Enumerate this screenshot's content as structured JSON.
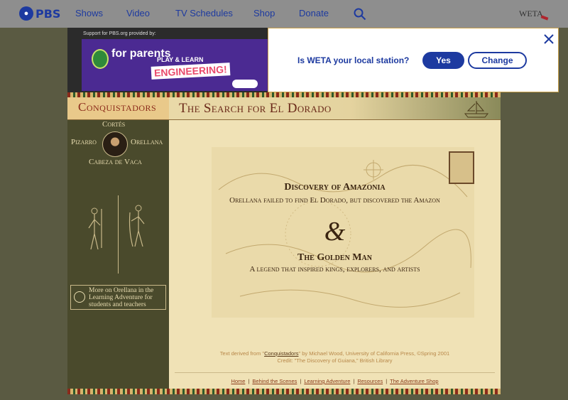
{
  "nav": {
    "logo": "PBS",
    "items": [
      "Shows",
      "Video",
      "TV Schedules",
      "Shop",
      "Donate"
    ],
    "station_logo": "WETA"
  },
  "ad": {
    "support_text": "Support for PBS.org provided by:",
    "brand": "for parents",
    "tagline": "PLAY & LEARN",
    "headline": "ENGINEERING!"
  },
  "popup": {
    "question": "Is WETA your local station?",
    "yes_label": "Yes",
    "change_label": "Change"
  },
  "sidebar": {
    "logo": "Conquistadors",
    "names": {
      "top": "Cortés",
      "left": "Pizarro",
      "right": "Orellana",
      "bottom": "Cabeza de Vaca"
    },
    "more_text": "More on Orellana in the Learning Adventure for students and teachers"
  },
  "page": {
    "title": "The Search for El Dorado",
    "section1": {
      "heading": "Discovery of Amazonia",
      "subheading": "Orellana failed to find El Dorado, but discovered the Amazon"
    },
    "ampersand": "&",
    "section2": {
      "heading": "The Golden Man",
      "subheading": "A legend that inspired kings, explorers, and artists"
    },
    "credit_line1_pre": "Text derived from \"",
    "credit_link": "Conquistadors",
    "credit_line1_post": "\" by Michael Wood, University of California Press, ©Spring 2001",
    "credit_line2": "Credit: \"The Discovery of Guiana,\" British Library"
  },
  "footer": {
    "links": [
      "Home",
      "Behind the Scenes",
      "Learning Adventure",
      "Resources",
      "The Adventure Shop"
    ]
  },
  "colors": {
    "pbs_blue": "#1d3aa0",
    "parchment": "#f0e2b6",
    "panel": "#4a4a2c"
  }
}
